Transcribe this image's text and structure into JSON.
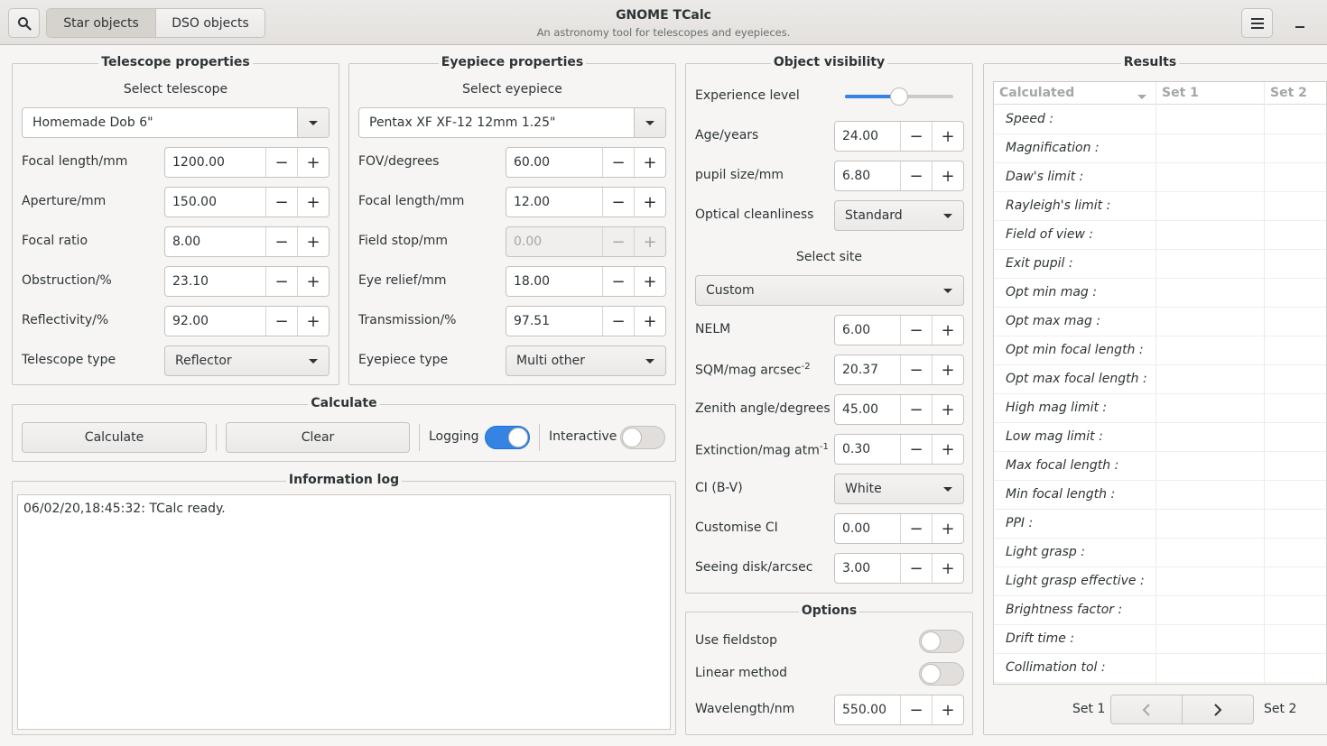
{
  "header": {
    "title": "GNOME TCalc",
    "subtitle": "An astronomy tool for telescopes and eyepieces.",
    "tabs": [
      "Star objects",
      "DSO objects"
    ],
    "active_tab": 0,
    "search_glyph": "⌕",
    "menu_glyph": "≡",
    "minimize_glyph": "–",
    "icons": [
      "search-icon",
      "hamburger-menu-icon",
      "minimize-icon"
    ]
  },
  "telescope": {
    "title": "Telescope properties",
    "select_label": "Select telescope",
    "selected": "Homemade Dob 6\"",
    "fields": [
      {
        "label": "Focal length/mm",
        "value": "1200.00"
      },
      {
        "label": "Aperture/mm",
        "value": "150.00"
      },
      {
        "label": "Focal ratio",
        "value": "8.00"
      },
      {
        "label": "Obstruction/%",
        "value": "23.10"
      },
      {
        "label": "Reflectivity/%",
        "value": "92.00"
      }
    ],
    "type_label": "Telescope type",
    "type_value": "Reflector"
  },
  "eyepiece": {
    "title": "Eyepiece properties",
    "select_label": "Select eyepiece",
    "selected": "Pentax XF XF-12 12mm 1.25\"",
    "fields": [
      {
        "label": "FOV/degrees",
        "value": "60.00"
      },
      {
        "label": "Focal length/mm",
        "value": "12.00"
      },
      {
        "label": "Field stop/mm",
        "value": "0.00",
        "disabled": true
      },
      {
        "label": "Eye relief/mm",
        "value": "18.00"
      },
      {
        "label": "Transmission/%",
        "value": "97.51"
      }
    ],
    "type_label": "Eyepiece type",
    "type_value": "Multi other"
  },
  "calculate": {
    "title": "Calculate",
    "calculate_label": "Calculate",
    "clear_label": "Clear",
    "logging_label": "Logging",
    "logging_on": true,
    "interactive_label": "Interactive",
    "interactive_on": false
  },
  "log": {
    "title": "Information log",
    "text": "06/02/20,18:45:32: TCalc ready."
  },
  "visibility": {
    "title": "Object visibility",
    "experience_label": "Experience level",
    "experience_level": 0.5,
    "age_label": "Age/years",
    "age_value": "24.00",
    "pupil_label": "pupil size/mm",
    "pupil_value": "6.80",
    "cleanliness_label": "Optical cleanliness",
    "cleanliness_value": "Standard",
    "site_label": "Select site",
    "site_value": "Custom",
    "nelm_label": "NELM",
    "nelm_value": "6.00",
    "sqm_label": "SQM/mag arcsec",
    "sqm_sup": "-2",
    "sqm_value": "20.37",
    "zenith_label": "Zenith angle/degrees",
    "zenith_value": "45.00",
    "extinction_label": "Extinction/mag atm",
    "extinction_sup": "-1",
    "extinction_value": "0.30",
    "ci_label": "CI (B-V)",
    "ci_value": "White",
    "custom_ci_label": "Customise CI",
    "custom_ci_value": "0.00",
    "seeing_label": "Seeing disk/arcsec",
    "seeing_value": "3.00"
  },
  "options": {
    "title": "Options",
    "fieldstop_label": "Use fieldstop",
    "fieldstop_on": false,
    "linear_label": "Linear method",
    "linear_on": false,
    "wavelength_label": "Wavelength/nm",
    "wavelength_value": "550.00"
  },
  "results": {
    "title": "Results",
    "columns": [
      "Calculated",
      "Set 1",
      "Set 2"
    ],
    "rows": [
      "Speed :",
      "Magnification :",
      "Daw's limit :",
      "Rayleigh's limit :",
      "Field of view :",
      "Exit pupil :",
      "Opt min mag :",
      "Opt max mag :",
      "Opt min focal length :",
      "Opt max focal length :",
      "High mag limit :",
      "Low mag limit :",
      "Max focal length :",
      "Min focal length :",
      "PPI :",
      "Light grasp :",
      "Light grasp effective :",
      "Brightness factor :",
      "Drift time :",
      "Collimation tol :"
    ],
    "set1_label": "Set 1",
    "set2_label": "Set 2",
    "prev_glyph": "‹",
    "next_glyph": "›"
  },
  "minus_glyph": "−",
  "plus_glyph": "+"
}
